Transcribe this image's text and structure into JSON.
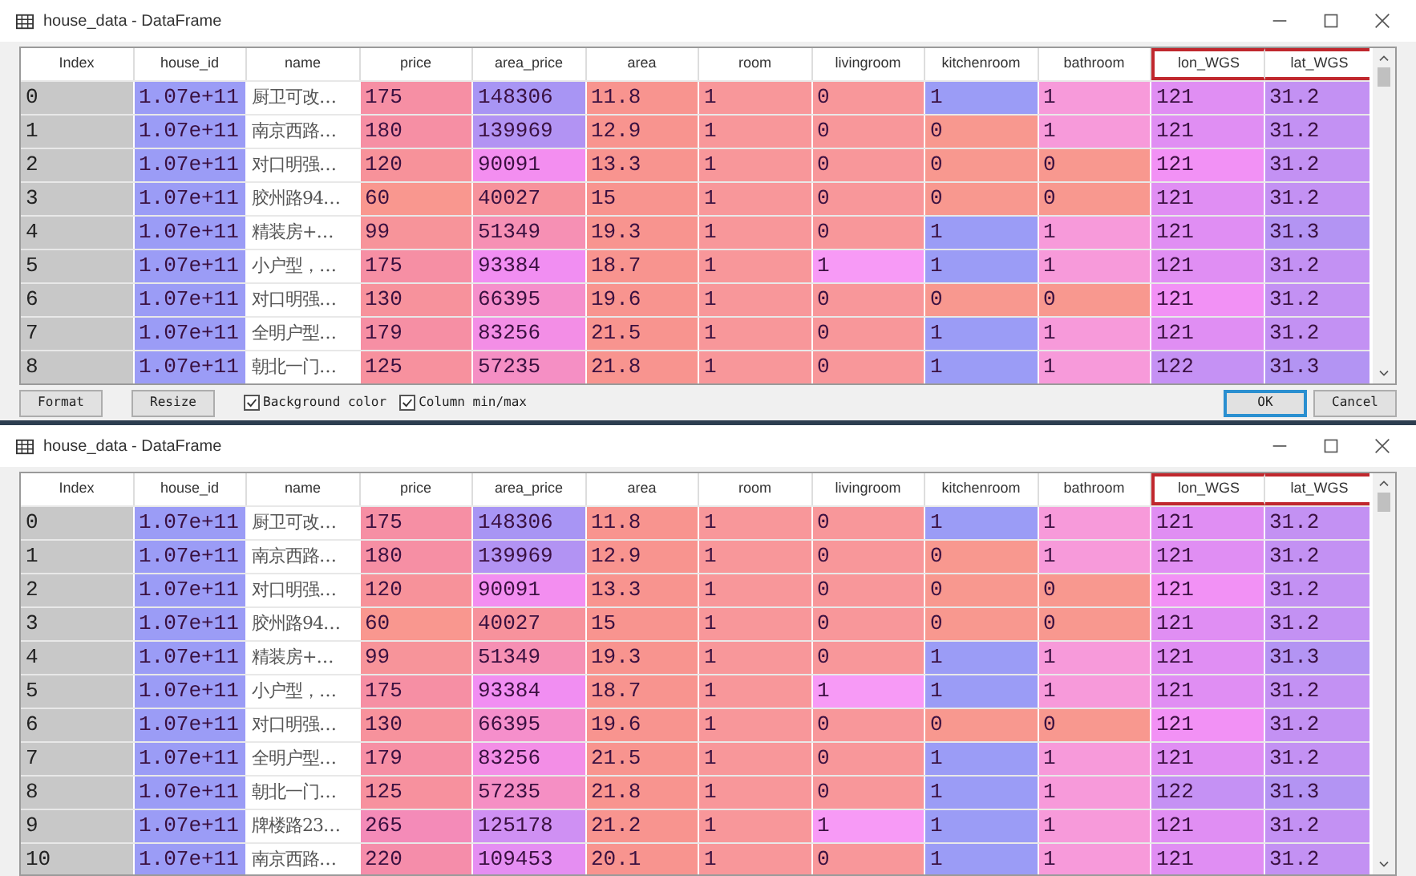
{
  "windows": [
    {
      "title": "house_data - DataFrame",
      "table": {
        "columns": [
          {
            "label": "Index",
            "highlighted": false
          },
          {
            "label": "house_id",
            "highlighted": false
          },
          {
            "label": "name",
            "highlighted": false
          },
          {
            "label": "price",
            "highlighted": false
          },
          {
            "label": "area_price",
            "highlighted": false
          },
          {
            "label": "area",
            "highlighted": false
          },
          {
            "label": "room",
            "highlighted": false
          },
          {
            "label": "livingroom",
            "highlighted": false
          },
          {
            "label": "kitchenroom",
            "highlighted": false
          },
          {
            "label": "bathroom",
            "highlighted": false
          },
          {
            "label": "lon_WGS",
            "highlighted": true
          },
          {
            "label": "lat_WGS",
            "highlighted": true
          }
        ],
        "rows": [
          {
            "cells": [
              {
                "text": "0"
              },
              {
                "text": "1.07e+11",
                "color": "#9b9cf6"
              },
              {
                "text": "厨卫可改…",
                "color": "#ffffff"
              },
              {
                "text": "175",
                "color": "#f68fa4"
              },
              {
                "text": "148306",
                "color": "#a895f4"
              },
              {
                "text": "11.8",
                "color": "#f8948f"
              },
              {
                "text": "1",
                "color": "#f8979a"
              },
              {
                "text": "0",
                "color": "#f8979a"
              },
              {
                "text": "1",
                "color": "#9b9cf6"
              },
              {
                "text": "1",
                "color": "#f79ada"
              },
              {
                "text": "121",
                "color": "#e08ef3"
              },
              {
                "text": "31.2",
                "color": "#c391f3"
              }
            ]
          },
          {
            "cells": [
              {
                "text": "1"
              },
              {
                "text": "1.07e+11",
                "color": "#9b9cf6"
              },
              {
                "text": "南京西路…",
                "color": "#ffffff"
              },
              {
                "text": "180",
                "color": "#f68fa4"
              },
              {
                "text": "139969",
                "color": "#b293f3"
              },
              {
                "text": "12.9",
                "color": "#f8948f"
              },
              {
                "text": "1",
                "color": "#f8979a"
              },
              {
                "text": "0",
                "color": "#f8979a"
              },
              {
                "text": "0",
                "color": "#f8988f"
              },
              {
                "text": "1",
                "color": "#f79ada"
              },
              {
                "text": "121",
                "color": "#e08ef3"
              },
              {
                "text": "31.2",
                "color": "#c391f3"
              }
            ]
          },
          {
            "cells": [
              {
                "text": "2"
              },
              {
                "text": "1.07e+11",
                "color": "#9b9cf6"
              },
              {
                "text": "对口明强…",
                "color": "#ffffff"
              },
              {
                "text": "120",
                "color": "#f7929a"
              },
              {
                "text": "90091",
                "color": "#f38ef0"
              },
              {
                "text": "13.3",
                "color": "#f8948f"
              },
              {
                "text": "1",
                "color": "#f8979a"
              },
              {
                "text": "0",
                "color": "#f8979a"
              },
              {
                "text": "0",
                "color": "#f8988f"
              },
              {
                "text": "0",
                "color": "#f8988f"
              },
              {
                "text": "121",
                "color": "#f291f5"
              },
              {
                "text": "31.2",
                "color": "#c391f3"
              }
            ]
          },
          {
            "cells": [
              {
                "text": "3"
              },
              {
                "text": "1.07e+11",
                "color": "#9b9cf6"
              },
              {
                "text": "胶州路94…",
                "color": "#ffffff"
              },
              {
                "text": "60",
                "color": "#f9978f"
              },
              {
                "text": "40027",
                "color": "#f7929c"
              },
              {
                "text": "15",
                "color": "#f8948f"
              },
              {
                "text": "1",
                "color": "#f8979a"
              },
              {
                "text": "0",
                "color": "#f8979a"
              },
              {
                "text": "0",
                "color": "#f8988f"
              },
              {
                "text": "0",
                "color": "#f8988f"
              },
              {
                "text": "121",
                "color": "#e08ef3"
              },
              {
                "text": "31.2",
                "color": "#c391f3"
              }
            ]
          },
          {
            "cells": [
              {
                "text": "4"
              },
              {
                "text": "1.07e+11",
                "color": "#9b9cf6"
              },
              {
                "text": "精装房+…",
                "color": "#ffffff"
              },
              {
                "text": "99",
                "color": "#f7949a"
              },
              {
                "text": "51349",
                "color": "#f690b4"
              },
              {
                "text": "19.3",
                "color": "#f8948f"
              },
              {
                "text": "1",
                "color": "#f8979a"
              },
              {
                "text": "0",
                "color": "#f8979a"
              },
              {
                "text": "1",
                "color": "#9b9cf6"
              },
              {
                "text": "1",
                "color": "#f79ada"
              },
              {
                "text": "121",
                "color": "#e08ef3"
              },
              {
                "text": "31.3",
                "color": "#b394f3"
              }
            ]
          },
          {
            "cells": [
              {
                "text": "5"
              },
              {
                "text": "1.07e+11",
                "color": "#9b9cf6"
              },
              {
                "text": "小户型，…",
                "color": "#ffffff"
              },
              {
                "text": "175",
                "color": "#f68fa4"
              },
              {
                "text": "93384",
                "color": "#f18ef2"
              },
              {
                "text": "18.7",
                "color": "#f8948f"
              },
              {
                "text": "1",
                "color": "#f8979a"
              },
              {
                "text": "1",
                "color": "#f79af6"
              },
              {
                "text": "1",
                "color": "#9b9cf6"
              },
              {
                "text": "1",
                "color": "#f79ada"
              },
              {
                "text": "121",
                "color": "#e08ef3"
              },
              {
                "text": "31.2",
                "color": "#c391f3"
              }
            ]
          },
          {
            "cells": [
              {
                "text": "6"
              },
              {
                "text": "1.07e+11",
                "color": "#9b9cf6"
              },
              {
                "text": "对口明强…",
                "color": "#ffffff"
              },
              {
                "text": "130",
                "color": "#f7929c"
              },
              {
                "text": "66395",
                "color": "#f58fcb"
              },
              {
                "text": "19.6",
                "color": "#f8948f"
              },
              {
                "text": "1",
                "color": "#f8979a"
              },
              {
                "text": "0",
                "color": "#f8979a"
              },
              {
                "text": "0",
                "color": "#f8988f"
              },
              {
                "text": "0",
                "color": "#f8988f"
              },
              {
                "text": "121",
                "color": "#f291f5"
              },
              {
                "text": "31.2",
                "color": "#c391f3"
              }
            ]
          },
          {
            "cells": [
              {
                "text": "7"
              },
              {
                "text": "1.07e+11",
                "color": "#9b9cf6"
              },
              {
                "text": "全明户型…",
                "color": "#ffffff"
              },
              {
                "text": "179",
                "color": "#f68fa4"
              },
              {
                "text": "83256",
                "color": "#f38ee6"
              },
              {
                "text": "21.5",
                "color": "#f8948f"
              },
              {
                "text": "1",
                "color": "#f8979a"
              },
              {
                "text": "0",
                "color": "#f8979a"
              },
              {
                "text": "1",
                "color": "#9b9cf6"
              },
              {
                "text": "1",
                "color": "#f79ada"
              },
              {
                "text": "121",
                "color": "#e08ef3"
              },
              {
                "text": "31.2",
                "color": "#c391f3"
              }
            ]
          },
          {
            "cells": [
              {
                "text": "8"
              },
              {
                "text": "1.07e+11",
                "color": "#9b9cf6"
              },
              {
                "text": "朝北一门…",
                "color": "#ffffff"
              },
              {
                "text": "125",
                "color": "#f7919e"
              },
              {
                "text": "57235",
                "color": "#f58fc4"
              },
              {
                "text": "21.8",
                "color": "#f8948f"
              },
              {
                "text": "1",
                "color": "#f8979a"
              },
              {
                "text": "0",
                "color": "#f8979a"
              },
              {
                "text": "1",
                "color": "#9b9cf6"
              },
              {
                "text": "1",
                "color": "#f79ada"
              },
              {
                "text": "122",
                "color": "#c591f4"
              },
              {
                "text": "31.3",
                "color": "#b394f3"
              }
            ]
          }
        ]
      },
      "footer": {
        "left_buttons": [
          "Format",
          "Resize"
        ],
        "checkboxes": [
          {
            "label": "Background color",
            "checked": true
          },
          {
            "label": "Column min/max",
            "checked": true
          }
        ],
        "right_buttons": [
          {
            "label": "OK",
            "selected": true
          },
          {
            "label": "Cancel",
            "selected": false
          }
        ]
      }
    },
    {
      "title": "house_data - DataFrame",
      "table": {
        "columns": [
          {
            "label": "Index",
            "highlighted": false
          },
          {
            "label": "house_id",
            "highlighted": false
          },
          {
            "label": "name",
            "highlighted": false
          },
          {
            "label": "price",
            "highlighted": false
          },
          {
            "label": "area_price",
            "highlighted": false
          },
          {
            "label": "area",
            "highlighted": false
          },
          {
            "label": "room",
            "highlighted": false
          },
          {
            "label": "livingroom",
            "highlighted": false
          },
          {
            "label": "kitchenroom",
            "highlighted": false
          },
          {
            "label": "bathroom",
            "highlighted": false
          },
          {
            "label": "lon_WGS",
            "highlighted": true
          },
          {
            "label": "lat_WGS",
            "highlighted": true
          }
        ],
        "rows": [
          {
            "cells": [
              {
                "text": "0"
              },
              {
                "text": "1.07e+11",
                "color": "#9b9cf6"
              },
              {
                "text": "厨卫可改…",
                "color": "#ffffff"
              },
              {
                "text": "175",
                "color": "#f68fa4"
              },
              {
                "text": "148306",
                "color": "#a895f4"
              },
              {
                "text": "11.8",
                "color": "#f8948f"
              },
              {
                "text": "1",
                "color": "#f8979a"
              },
              {
                "text": "0",
                "color": "#f8979a"
              },
              {
                "text": "1",
                "color": "#9b9cf6"
              },
              {
                "text": "1",
                "color": "#f79ada"
              },
              {
                "text": "121",
                "color": "#e08ef3"
              },
              {
                "text": "31.2",
                "color": "#c391f3"
              }
            ]
          },
          {
            "cells": [
              {
                "text": "1"
              },
              {
                "text": "1.07e+11",
                "color": "#9b9cf6"
              },
              {
                "text": "南京西路…",
                "color": "#ffffff"
              },
              {
                "text": "180",
                "color": "#f68fa4"
              },
              {
                "text": "139969",
                "color": "#b293f3"
              },
              {
                "text": "12.9",
                "color": "#f8948f"
              },
              {
                "text": "1",
                "color": "#f8979a"
              },
              {
                "text": "0",
                "color": "#f8979a"
              },
              {
                "text": "0",
                "color": "#f8988f"
              },
              {
                "text": "1",
                "color": "#f79ada"
              },
              {
                "text": "121",
                "color": "#e08ef3"
              },
              {
                "text": "31.2",
                "color": "#c391f3"
              }
            ]
          },
          {
            "cells": [
              {
                "text": "2"
              },
              {
                "text": "1.07e+11",
                "color": "#9b9cf6"
              },
              {
                "text": "对口明强…",
                "color": "#ffffff"
              },
              {
                "text": "120",
                "color": "#f7929a"
              },
              {
                "text": "90091",
                "color": "#f38ef0"
              },
              {
                "text": "13.3",
                "color": "#f8948f"
              },
              {
                "text": "1",
                "color": "#f8979a"
              },
              {
                "text": "0",
                "color": "#f8979a"
              },
              {
                "text": "0",
                "color": "#f8988f"
              },
              {
                "text": "0",
                "color": "#f8988f"
              },
              {
                "text": "121",
                "color": "#f291f5"
              },
              {
                "text": "31.2",
                "color": "#c391f3"
              }
            ]
          },
          {
            "cells": [
              {
                "text": "3"
              },
              {
                "text": "1.07e+11",
                "color": "#9b9cf6"
              },
              {
                "text": "胶州路94…",
                "color": "#ffffff"
              },
              {
                "text": "60",
                "color": "#f9978f"
              },
              {
                "text": "40027",
                "color": "#f7929c"
              },
              {
                "text": "15",
                "color": "#f8948f"
              },
              {
                "text": "1",
                "color": "#f8979a"
              },
              {
                "text": "0",
                "color": "#f8979a"
              },
              {
                "text": "0",
                "color": "#f8988f"
              },
              {
                "text": "0",
                "color": "#f8988f"
              },
              {
                "text": "121",
                "color": "#e08ef3"
              },
              {
                "text": "31.2",
                "color": "#c391f3"
              }
            ]
          },
          {
            "cells": [
              {
                "text": "4"
              },
              {
                "text": "1.07e+11",
                "color": "#9b9cf6"
              },
              {
                "text": "精装房+…",
                "color": "#ffffff"
              },
              {
                "text": "99",
                "color": "#f7949a"
              },
              {
                "text": "51349",
                "color": "#f690b4"
              },
              {
                "text": "19.3",
                "color": "#f8948f"
              },
              {
                "text": "1",
                "color": "#f8979a"
              },
              {
                "text": "0",
                "color": "#f8979a"
              },
              {
                "text": "1",
                "color": "#9b9cf6"
              },
              {
                "text": "1",
                "color": "#f79ada"
              },
              {
                "text": "121",
                "color": "#e08ef3"
              },
              {
                "text": "31.3",
                "color": "#b394f3"
              }
            ]
          },
          {
            "cells": [
              {
                "text": "5"
              },
              {
                "text": "1.07e+11",
                "color": "#9b9cf6"
              },
              {
                "text": "小户型，…",
                "color": "#ffffff"
              },
              {
                "text": "175",
                "color": "#f68fa4"
              },
              {
                "text": "93384",
                "color": "#f18ef2"
              },
              {
                "text": "18.7",
                "color": "#f8948f"
              },
              {
                "text": "1",
                "color": "#f8979a"
              },
              {
                "text": "1",
                "color": "#f79af6"
              },
              {
                "text": "1",
                "color": "#9b9cf6"
              },
              {
                "text": "1",
                "color": "#f79ada"
              },
              {
                "text": "121",
                "color": "#e08ef3"
              },
              {
                "text": "31.2",
                "color": "#c391f3"
              }
            ]
          },
          {
            "cells": [
              {
                "text": "6"
              },
              {
                "text": "1.07e+11",
                "color": "#9b9cf6"
              },
              {
                "text": "对口明强…",
                "color": "#ffffff"
              },
              {
                "text": "130",
                "color": "#f7929c"
              },
              {
                "text": "66395",
                "color": "#f58fcb"
              },
              {
                "text": "19.6",
                "color": "#f8948f"
              },
              {
                "text": "1",
                "color": "#f8979a"
              },
              {
                "text": "0",
                "color": "#f8979a"
              },
              {
                "text": "0",
                "color": "#f8988f"
              },
              {
                "text": "0",
                "color": "#f8988f"
              },
              {
                "text": "121",
                "color": "#f291f5"
              },
              {
                "text": "31.2",
                "color": "#c391f3"
              }
            ]
          },
          {
            "cells": [
              {
                "text": "7"
              },
              {
                "text": "1.07e+11",
                "color": "#9b9cf6"
              },
              {
                "text": "全明户型…",
                "color": "#ffffff"
              },
              {
                "text": "179",
                "color": "#f68fa4"
              },
              {
                "text": "83256",
                "color": "#f38ee6"
              },
              {
                "text": "21.5",
                "color": "#f8948f"
              },
              {
                "text": "1",
                "color": "#f8979a"
              },
              {
                "text": "0",
                "color": "#f8979a"
              },
              {
                "text": "1",
                "color": "#9b9cf6"
              },
              {
                "text": "1",
                "color": "#f79ada"
              },
              {
                "text": "121",
                "color": "#e08ef3"
              },
              {
                "text": "31.2",
                "color": "#c391f3"
              }
            ]
          },
          {
            "cells": [
              {
                "text": "8"
              },
              {
                "text": "1.07e+11",
                "color": "#9b9cf6"
              },
              {
                "text": "朝北一门…",
                "color": "#ffffff"
              },
              {
                "text": "125",
                "color": "#f7919e"
              },
              {
                "text": "57235",
                "color": "#f58fc4"
              },
              {
                "text": "21.8",
                "color": "#f8948f"
              },
              {
                "text": "1",
                "color": "#f8979a"
              },
              {
                "text": "0",
                "color": "#f8979a"
              },
              {
                "text": "1",
                "color": "#9b9cf6"
              },
              {
                "text": "1",
                "color": "#f79ada"
              },
              {
                "text": "122",
                "color": "#c591f4"
              },
              {
                "text": "31.3",
                "color": "#b394f3"
              }
            ]
          },
          {
            "cells": [
              {
                "text": "9"
              },
              {
                "text": "1.07e+11",
                "color": "#9b9cf6"
              },
              {
                "text": "牌楼路23…",
                "color": "#ffffff"
              },
              {
                "text": "265",
                "color": "#f48bb8"
              },
              {
                "text": "125178",
                "color": "#cf90f3"
              },
              {
                "text": "21.2",
                "color": "#f8948f"
              },
              {
                "text": "1",
                "color": "#f8979a"
              },
              {
                "text": "1",
                "color": "#f79af6"
              },
              {
                "text": "1",
                "color": "#9b9cf6"
              },
              {
                "text": "1",
                "color": "#f79ada"
              },
              {
                "text": "121",
                "color": "#e08ef3"
              },
              {
                "text": "31.2",
                "color": "#c391f3"
              }
            ]
          },
          {
            "cells": [
              {
                "text": "10"
              },
              {
                "text": "1.07e+11",
                "color": "#9b9cf6"
              },
              {
                "text": "南京西路…",
                "color": "#ffffff"
              },
              {
                "text": "220",
                "color": "#f58daa"
              },
              {
                "text": "109453",
                "color": "#e58ef2"
              },
              {
                "text": "20.1",
                "color": "#f8948f"
              },
              {
                "text": "1",
                "color": "#f8979a"
              },
              {
                "text": "0",
                "color": "#f8979a"
              },
              {
                "text": "1",
                "color": "#9b9cf6"
              },
              {
                "text": "1",
                "color": "#f79ada"
              },
              {
                "text": "121",
                "color": "#e08ef3"
              },
              {
                "text": "31.2",
                "color": "#c391f3"
              }
            ]
          }
        ]
      }
    }
  ]
}
